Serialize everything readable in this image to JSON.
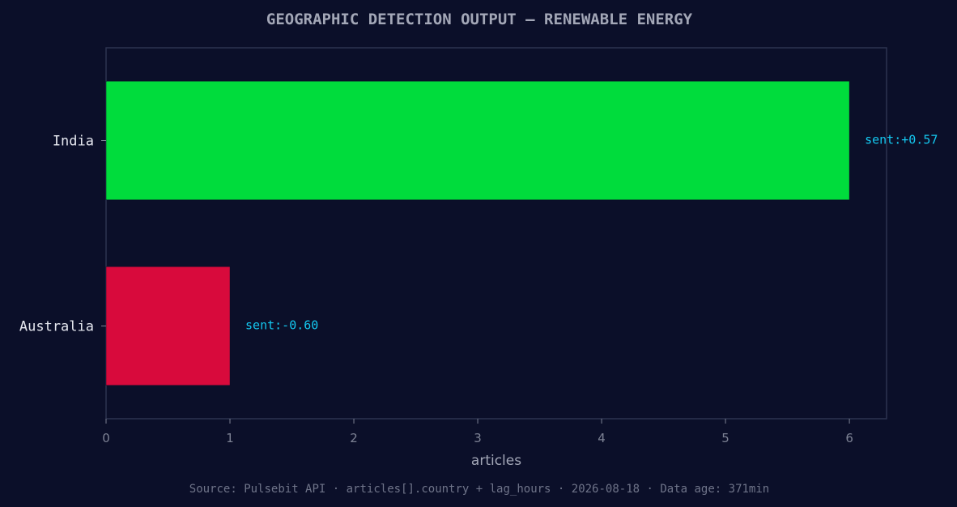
{
  "chart_data": {
    "type": "bar",
    "orientation": "horizontal",
    "title": "GEOGRAPHIC DETECTION OUTPUT — RENEWABLE ENERGY",
    "xlabel": "articles",
    "ylabel": "",
    "categories": [
      "India",
      "Australia"
    ],
    "values": [
      6,
      1
    ],
    "bar_colors": [
      "#00dc3c",
      "#d80a3c"
    ],
    "annotations": [
      "sent:+0.57",
      "sent:-0.60"
    ],
    "xlim": [
      0,
      6.3
    ],
    "xticks": [
      0,
      1,
      2,
      3,
      4,
      5,
      6
    ],
    "grid": false,
    "legend": "none"
  },
  "footer": {
    "source": "Source: Pulsebit API · articles[].country + lag_hours · 2026-08-18 · Data age: 371min"
  },
  "colors": {
    "background": "#0b0f29",
    "axes_frame": "#2c3350",
    "title": "#a3a7b7",
    "tick_label": "#7d8294",
    "category_label": "#e6e8f0",
    "annotation": "#14c8f0",
    "footer": "#6f7489"
  }
}
